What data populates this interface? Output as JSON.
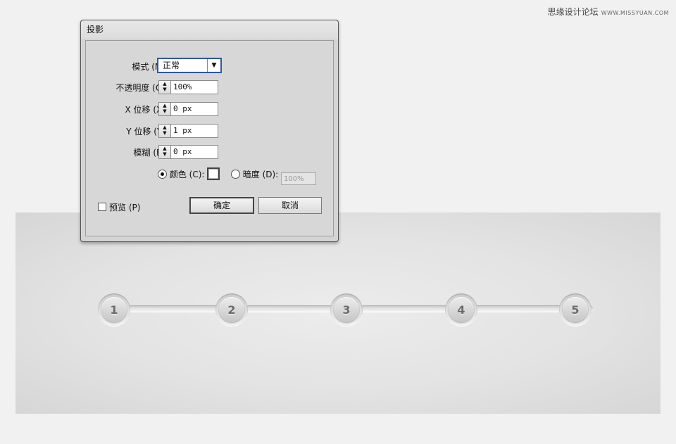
{
  "watermark": {
    "main": "思缘设计论坛",
    "sub": "WWW.MISSYUAN.COM"
  },
  "dialog": {
    "title": "投影",
    "mode": {
      "label": "模式 (M):",
      "value": "正常"
    },
    "opacity": {
      "label": "不透明度 (O):",
      "value": "100%"
    },
    "x_offset": {
      "label": "X 位移 (X):",
      "value": "0 px"
    },
    "y_offset": {
      "label": "Y 位移 (Y):",
      "value": "1 px"
    },
    "blur": {
      "label": "模糊 (B):",
      "value": "0 px"
    },
    "color_option": {
      "label": "颜色 (C):",
      "selected": true,
      "swatch": "#ffffff"
    },
    "darkness_option": {
      "label": "暗度 (D):",
      "selected": false,
      "value": "100%"
    },
    "preview": {
      "label": "预览 (P)",
      "checked": false
    },
    "ok_label": "确定",
    "cancel_label": "取消"
  },
  "steps": [
    "1",
    "2",
    "3",
    "4",
    "5"
  ],
  "colors": {
    "accent": "#2d58a8",
    "canvas": "#e3e3e3",
    "page": "#f2f1f2"
  }
}
